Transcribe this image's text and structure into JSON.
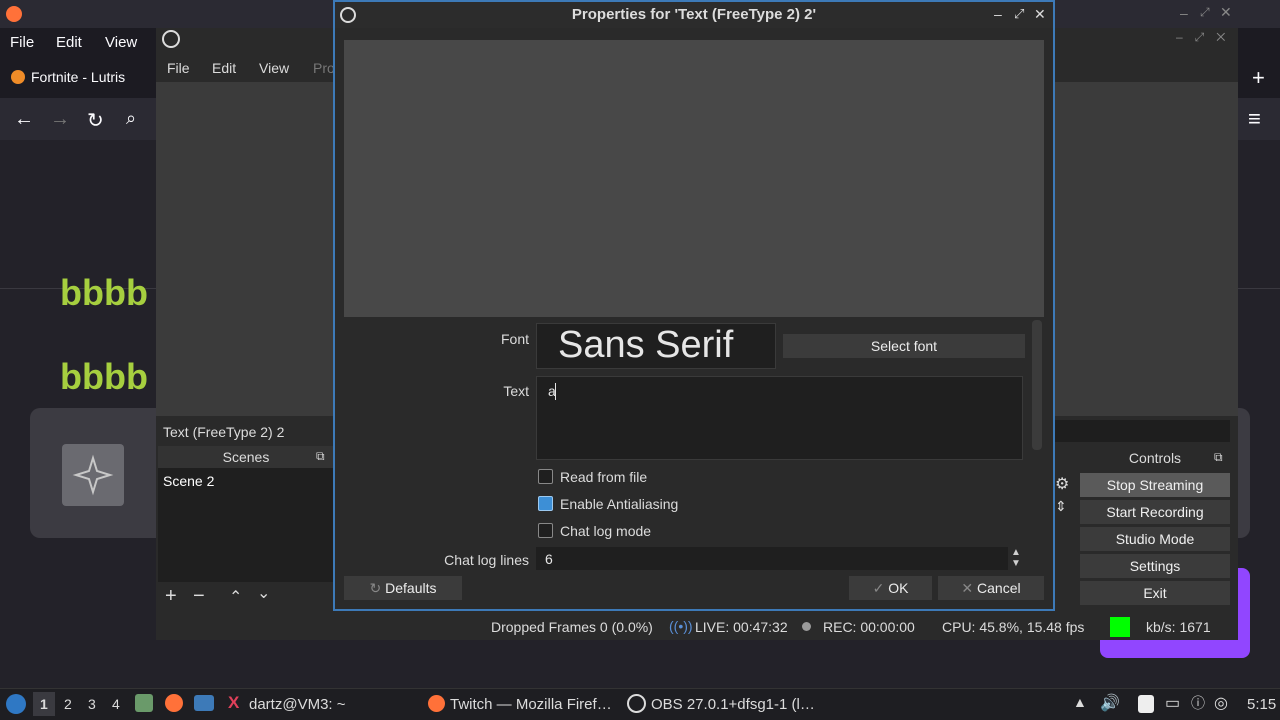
{
  "firefox": {
    "menu": [
      "File",
      "Edit",
      "View"
    ],
    "tab_title": "Fortnite - Lutris",
    "content_text_1": "bbbb",
    "content_text_2": "bbbb",
    "new_tab": "+",
    "hamburger": "≡"
  },
  "obs": {
    "menu": [
      "File",
      "Edit",
      "View",
      "Pro"
    ],
    "source_label": "Text (FreeType 2) 2",
    "scenes_title": "Scenes",
    "scenes": [
      "Scene 2"
    ],
    "controls_title": "Controls",
    "controls": [
      "Stop Streaming",
      "Start Recording",
      "Studio Mode",
      "Settings",
      "Exit"
    ],
    "status": {
      "dropped": "Dropped Frames 0 (0.0%)",
      "live": "LIVE: 00:47:32",
      "rec": "REC: 00:00:00",
      "cpu": "CPU: 45.8%, 15.48 fps",
      "kbps": "kb/s: 1671",
      "kbps_color": "#00ff00"
    }
  },
  "dialog": {
    "title": "Properties for 'Text (FreeType 2) 2'",
    "font_label": "Font",
    "font_name": "Sans Serif",
    "select_font": "Select font",
    "text_label": "Text",
    "text_value": "a",
    "read_from_file": "Read from file",
    "read_from_file_checked": false,
    "antialiasing": "Enable Antialiasing",
    "antialiasing_checked": true,
    "chat_log_mode": "Chat log mode",
    "chat_log_mode_checked": false,
    "chat_log_lines_label": "Chat log lines",
    "chat_log_lines_value": "6",
    "defaults": "Defaults",
    "ok": "OK",
    "cancel": "Cancel"
  },
  "taskbar": {
    "workspaces": [
      "1",
      "2",
      "3",
      "4"
    ],
    "active_workspace": "1",
    "terminal": "dartz@VM3: ~",
    "firefox": "Twitch — Mozilla Firef…",
    "obs": "OBS 27.0.1+dfsg1-1 (l…",
    "clock": "5:15"
  }
}
